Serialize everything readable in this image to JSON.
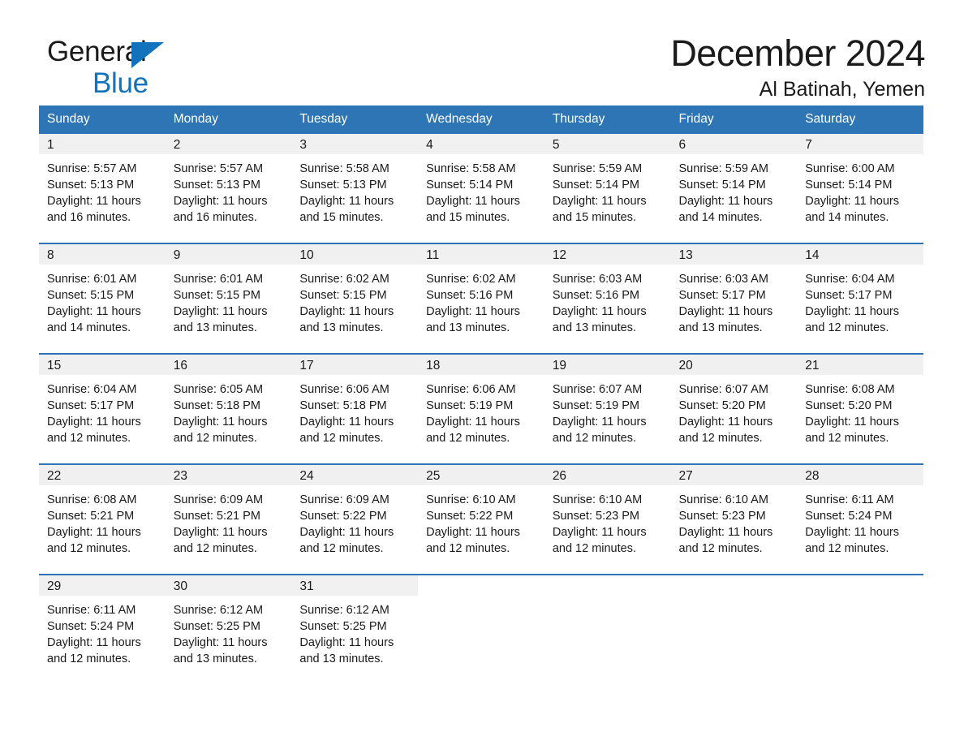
{
  "brand": {
    "name_part1": "General",
    "name_part2": "Blue",
    "triangle_icon": "brand-triangle-icon"
  },
  "header": {
    "month_title": "December 2024",
    "location": "Al Batinah, Yemen"
  },
  "colors": {
    "header_blue": "#2e75b6",
    "brand_blue": "#1272bc",
    "daynum_band": "#f0f0f0",
    "text": "#1a1a1a"
  },
  "calendar": {
    "weekday_headers": [
      "Sunday",
      "Monday",
      "Tuesday",
      "Wednesday",
      "Thursday",
      "Friday",
      "Saturday"
    ],
    "weeks": [
      [
        {
          "day": "1",
          "sunrise": "Sunrise: 5:57 AM",
          "sunset": "Sunset: 5:13 PM",
          "daylight": "Daylight: 11 hours and 16 minutes."
        },
        {
          "day": "2",
          "sunrise": "Sunrise: 5:57 AM",
          "sunset": "Sunset: 5:13 PM",
          "daylight": "Daylight: 11 hours and 16 minutes."
        },
        {
          "day": "3",
          "sunrise": "Sunrise: 5:58 AM",
          "sunset": "Sunset: 5:13 PM",
          "daylight": "Daylight: 11 hours and 15 minutes."
        },
        {
          "day": "4",
          "sunrise": "Sunrise: 5:58 AM",
          "sunset": "Sunset: 5:14 PM",
          "daylight": "Daylight: 11 hours and 15 minutes."
        },
        {
          "day": "5",
          "sunrise": "Sunrise: 5:59 AM",
          "sunset": "Sunset: 5:14 PM",
          "daylight": "Daylight: 11 hours and 15 minutes."
        },
        {
          "day": "6",
          "sunrise": "Sunrise: 5:59 AM",
          "sunset": "Sunset: 5:14 PM",
          "daylight": "Daylight: 11 hours and 14 minutes."
        },
        {
          "day": "7",
          "sunrise": "Sunrise: 6:00 AM",
          "sunset": "Sunset: 5:14 PM",
          "daylight": "Daylight: 11 hours and 14 minutes."
        }
      ],
      [
        {
          "day": "8",
          "sunrise": "Sunrise: 6:01 AM",
          "sunset": "Sunset: 5:15 PM",
          "daylight": "Daylight: 11 hours and 14 minutes."
        },
        {
          "day": "9",
          "sunrise": "Sunrise: 6:01 AM",
          "sunset": "Sunset: 5:15 PM",
          "daylight": "Daylight: 11 hours and 13 minutes."
        },
        {
          "day": "10",
          "sunrise": "Sunrise: 6:02 AM",
          "sunset": "Sunset: 5:15 PM",
          "daylight": "Daylight: 11 hours and 13 minutes."
        },
        {
          "day": "11",
          "sunrise": "Sunrise: 6:02 AM",
          "sunset": "Sunset: 5:16 PM",
          "daylight": "Daylight: 11 hours and 13 minutes."
        },
        {
          "day": "12",
          "sunrise": "Sunrise: 6:03 AM",
          "sunset": "Sunset: 5:16 PM",
          "daylight": "Daylight: 11 hours and 13 minutes."
        },
        {
          "day": "13",
          "sunrise": "Sunrise: 6:03 AM",
          "sunset": "Sunset: 5:17 PM",
          "daylight": "Daylight: 11 hours and 13 minutes."
        },
        {
          "day": "14",
          "sunrise": "Sunrise: 6:04 AM",
          "sunset": "Sunset: 5:17 PM",
          "daylight": "Daylight: 11 hours and 12 minutes."
        }
      ],
      [
        {
          "day": "15",
          "sunrise": "Sunrise: 6:04 AM",
          "sunset": "Sunset: 5:17 PM",
          "daylight": "Daylight: 11 hours and 12 minutes."
        },
        {
          "day": "16",
          "sunrise": "Sunrise: 6:05 AM",
          "sunset": "Sunset: 5:18 PM",
          "daylight": "Daylight: 11 hours and 12 minutes."
        },
        {
          "day": "17",
          "sunrise": "Sunrise: 6:06 AM",
          "sunset": "Sunset: 5:18 PM",
          "daylight": "Daylight: 11 hours and 12 minutes."
        },
        {
          "day": "18",
          "sunrise": "Sunrise: 6:06 AM",
          "sunset": "Sunset: 5:19 PM",
          "daylight": "Daylight: 11 hours and 12 minutes."
        },
        {
          "day": "19",
          "sunrise": "Sunrise: 6:07 AM",
          "sunset": "Sunset: 5:19 PM",
          "daylight": "Daylight: 11 hours and 12 minutes."
        },
        {
          "day": "20",
          "sunrise": "Sunrise: 6:07 AM",
          "sunset": "Sunset: 5:20 PM",
          "daylight": "Daylight: 11 hours and 12 minutes."
        },
        {
          "day": "21",
          "sunrise": "Sunrise: 6:08 AM",
          "sunset": "Sunset: 5:20 PM",
          "daylight": "Daylight: 11 hours and 12 minutes."
        }
      ],
      [
        {
          "day": "22",
          "sunrise": "Sunrise: 6:08 AM",
          "sunset": "Sunset: 5:21 PM",
          "daylight": "Daylight: 11 hours and 12 minutes."
        },
        {
          "day": "23",
          "sunrise": "Sunrise: 6:09 AM",
          "sunset": "Sunset: 5:21 PM",
          "daylight": "Daylight: 11 hours and 12 minutes."
        },
        {
          "day": "24",
          "sunrise": "Sunrise: 6:09 AM",
          "sunset": "Sunset: 5:22 PM",
          "daylight": "Daylight: 11 hours and 12 minutes."
        },
        {
          "day": "25",
          "sunrise": "Sunrise: 6:10 AM",
          "sunset": "Sunset: 5:22 PM",
          "daylight": "Daylight: 11 hours and 12 minutes."
        },
        {
          "day": "26",
          "sunrise": "Sunrise: 6:10 AM",
          "sunset": "Sunset: 5:23 PM",
          "daylight": "Daylight: 11 hours and 12 minutes."
        },
        {
          "day": "27",
          "sunrise": "Sunrise: 6:10 AM",
          "sunset": "Sunset: 5:23 PM",
          "daylight": "Daylight: 11 hours and 12 minutes."
        },
        {
          "day": "28",
          "sunrise": "Sunrise: 6:11 AM",
          "sunset": "Sunset: 5:24 PM",
          "daylight": "Daylight: 11 hours and 12 minutes."
        }
      ],
      [
        {
          "day": "29",
          "sunrise": "Sunrise: 6:11 AM",
          "sunset": "Sunset: 5:24 PM",
          "daylight": "Daylight: 11 hours and 12 minutes."
        },
        {
          "day": "30",
          "sunrise": "Sunrise: 6:12 AM",
          "sunset": "Sunset: 5:25 PM",
          "daylight": "Daylight: 11 hours and 13 minutes."
        },
        {
          "day": "31",
          "sunrise": "Sunrise: 6:12 AM",
          "sunset": "Sunset: 5:25 PM",
          "daylight": "Daylight: 11 hours and 13 minutes."
        },
        {
          "day": "",
          "sunrise": "",
          "sunset": "",
          "daylight": ""
        },
        {
          "day": "",
          "sunrise": "",
          "sunset": "",
          "daylight": ""
        },
        {
          "day": "",
          "sunrise": "",
          "sunset": "",
          "daylight": ""
        },
        {
          "day": "",
          "sunrise": "",
          "sunset": "",
          "daylight": ""
        }
      ]
    ]
  }
}
